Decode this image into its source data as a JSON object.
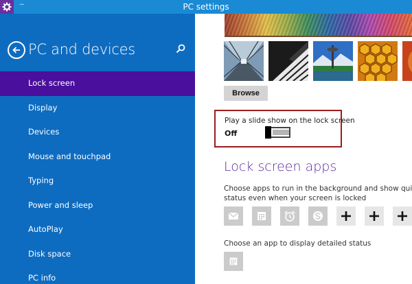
{
  "window": {
    "title": "PC settings",
    "menu_dots": "···",
    "app_icon": "gear-icon",
    "accent_color": "#1a8ad4"
  },
  "sidebar": {
    "title": "PC and devices",
    "back_icon": "back-arrow-icon",
    "search_icon": "search-icon",
    "background_color": "#0e6cc0",
    "active_color": "#4a0f9c",
    "items": [
      {
        "label": "Lock screen",
        "active": true
      },
      {
        "label": "Display",
        "active": false
      },
      {
        "label": "Devices",
        "active": false
      },
      {
        "label": "Mouse and touchpad",
        "active": false
      },
      {
        "label": "Typing",
        "active": false
      },
      {
        "label": "Power and sleep",
        "active": false
      },
      {
        "label": "AutoPlay",
        "active": false
      },
      {
        "label": "Disk space",
        "active": false
      },
      {
        "label": "PC info",
        "active": false
      }
    ]
  },
  "main": {
    "browse_label": "Browse",
    "slideshow": {
      "label": "Play a slide show on the lock screen",
      "state": "Off",
      "on": false
    },
    "lock_screen_apps": {
      "title": "Lock screen apps",
      "description": "Choose apps to run in the background and show quick status even when your screen is locked",
      "apps": [
        {
          "icon": "mail-icon"
        },
        {
          "icon": "calendar-icon"
        },
        {
          "icon": "alarm-icon"
        },
        {
          "icon": "skype-icon"
        },
        {
          "icon": "add-icon"
        },
        {
          "icon": "add-icon"
        },
        {
          "icon": "add-icon"
        }
      ]
    },
    "detailed_status": {
      "description": "Choose an app to display detailed status",
      "icon": "calendar-icon"
    },
    "accent_heading_color": "#5a2aa0",
    "highlight_box_color": "#9b1c1c"
  }
}
